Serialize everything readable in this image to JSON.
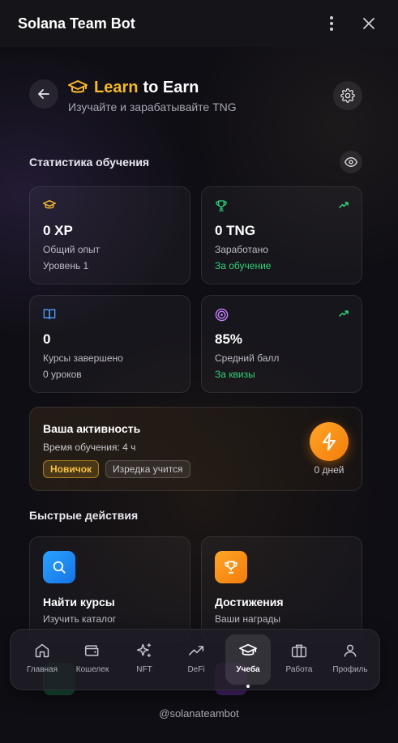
{
  "titlebar": {
    "title": "Solana Team Bot",
    "menu_icon": "more-vertical-icon",
    "close_icon": "close-icon"
  },
  "header": {
    "title_accent": "Learn",
    "title_rest": "to Earn",
    "subtitle": "Изучайте и зарабатывайте TNG",
    "accent_color": "#f7b928"
  },
  "stats": {
    "title": "Статистика обучения",
    "cards": [
      {
        "icon": "graduation-cap-icon",
        "value": "0 XP",
        "label": "Общий опыт",
        "sub": "Уровень 1"
      },
      {
        "icon": "trophy-icon",
        "value": "0 TNG",
        "label": "Заработано",
        "sub": "За обучение"
      },
      {
        "icon": "book-open-icon",
        "value": "0",
        "label": "Курсы завершено",
        "sub": "0 уроков"
      },
      {
        "icon": "target-icon",
        "value": "85%",
        "label": "Средний балл",
        "sub": "За квизы"
      }
    ]
  },
  "activity": {
    "title": "Ваша активность",
    "time": "Время обучения: 4 ч",
    "badge_level": "Новичок",
    "badge_freq": "Изредка учится",
    "streak": "0 дней"
  },
  "quick_actions": {
    "title": "Быстрые действия",
    "items": [
      {
        "icon": "search-icon",
        "title": "Найти курсы",
        "sub": "Изучить каталог"
      },
      {
        "icon": "trophy-icon",
        "title": "Достижения",
        "sub": "Ваши награды"
      }
    ]
  },
  "nav": {
    "tabs": [
      {
        "icon": "home-icon",
        "label": "Главная"
      },
      {
        "icon": "wallet-icon",
        "label": "Кошелек"
      },
      {
        "icon": "sparkles-icon",
        "label": "NFT"
      },
      {
        "icon": "trending-up-icon",
        "label": "DeFi"
      },
      {
        "icon": "graduation-cap-icon",
        "label": "Учеба"
      },
      {
        "icon": "briefcase-icon",
        "label": "Работа"
      },
      {
        "icon": "user-icon",
        "label": "Профиль"
      }
    ],
    "active": "Учеба"
  },
  "footer": {
    "handle": "@solanateambot"
  },
  "colors": {
    "green": "#2fd37a",
    "gold": "#f7b928",
    "blue": "#1a8cf0",
    "orange": "#f27d0c"
  }
}
